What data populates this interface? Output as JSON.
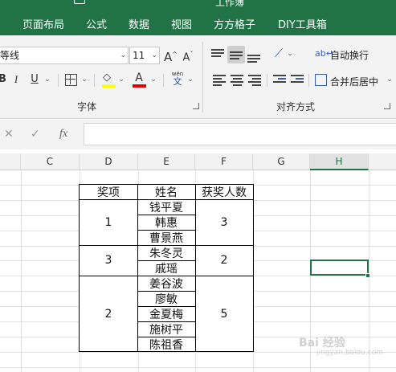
{
  "menubar": {
    "title": "工作簿",
    "tabs": [
      "页面布局",
      "公式",
      "数据",
      "视图",
      "方方格子",
      "DIY工具箱"
    ]
  },
  "ribbon": {
    "font_name": "等线",
    "font_size": "11",
    "grow_font": "A",
    "shrink_font": "A",
    "bold": "B",
    "italic": "I",
    "underline": "U",
    "phonetic": "wén",
    "phonetic_char": "文",
    "wrap_text": "自动换行",
    "merge_center": "合并后居中",
    "font_group_label": "字体",
    "align_group_label": "对齐方式",
    "font_color": "#e00000",
    "fill_color": "#ffff00"
  },
  "formula_bar": {
    "cancel": "✕",
    "enter": "✓",
    "fx": "fx",
    "value": ""
  },
  "grid": {
    "columns": [
      "C",
      "D",
      "E",
      "F",
      "G",
      "H"
    ],
    "selected_column": "H"
  },
  "table": {
    "headers": [
      "奖项",
      "姓名",
      "获奖人数"
    ],
    "groups": [
      {
        "award": "1",
        "names": [
          "钱平夏",
          "韩惠",
          "曹景燕"
        ],
        "count": "3"
      },
      {
        "award": "3",
        "names": [
          "朱冬灵",
          "戚瑶"
        ],
        "count": "2"
      },
      {
        "award": "2",
        "names": [
          "姜谷波",
          "廖敏",
          "金夏梅",
          "施树平",
          "陈祖香"
        ],
        "count": "5"
      }
    ]
  },
  "watermark": {
    "text": "Bai 经验",
    "sub": "jingyan.baidu.com"
  }
}
